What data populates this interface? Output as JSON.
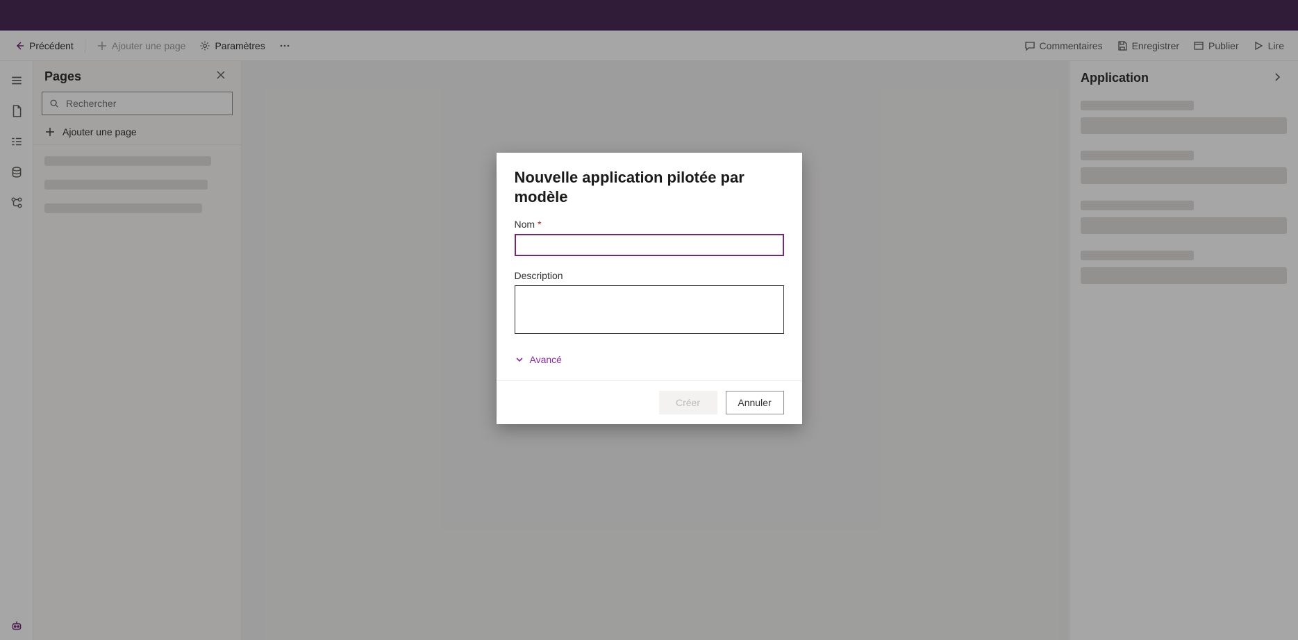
{
  "cmdbar": {
    "back_label": "Précédent",
    "add_page_label": "Ajouter une page",
    "settings_label": "Paramètres",
    "comments_label": "Commentaires",
    "save_label": "Enregistrer",
    "publish_label": "Publier",
    "play_label": "Lire"
  },
  "pages_panel": {
    "title": "Pages",
    "search_placeholder": "Rechercher",
    "add_page_label": "Ajouter une page"
  },
  "right_panel": {
    "title": "Application"
  },
  "dialog": {
    "title": "Nouvelle application pilotée par modèle",
    "name_label": "Nom",
    "description_label": "Description",
    "advanced_label": "Avancé",
    "create_label": "Créer",
    "cancel_label": "Annuler",
    "name_value": "",
    "description_value": ""
  }
}
